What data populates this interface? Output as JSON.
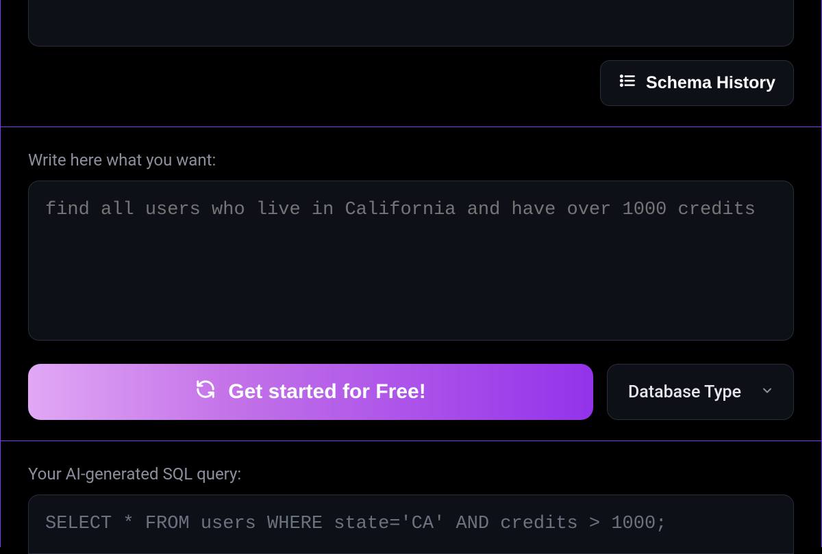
{
  "buttons": {
    "schema_history": "Schema History",
    "cta": "Get started for Free!",
    "db_type": "Database Type"
  },
  "input_section": {
    "label": "Write here what you want:",
    "placeholder": "find all users who live in California and have over 1000 credits"
  },
  "output_section": {
    "label": "Your AI-generated SQL query:",
    "value": "SELECT * FROM users WHERE state='CA' AND credits > 1000;"
  }
}
